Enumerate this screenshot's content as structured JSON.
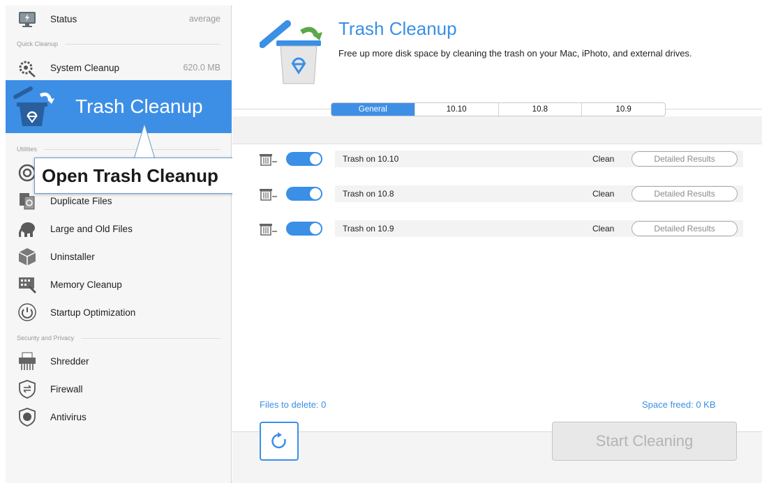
{
  "sidebar": {
    "status": {
      "label": "Status",
      "value": "average"
    },
    "section_quick": "Quick Cleanup",
    "system_cleanup": {
      "label": "System Cleanup",
      "value": "620.0 MB"
    },
    "selected": {
      "label": "Trash Cleanup"
    },
    "section_utilities": "Utilities",
    "duplicate_files": {
      "label": "Duplicate Files"
    },
    "large_old_files": {
      "label": "Large and Old Files"
    },
    "uninstaller": {
      "label": "Uninstaller"
    },
    "memory_cleanup": {
      "label": "Memory Cleanup"
    },
    "startup_optimization": {
      "label": "Startup Optimization"
    },
    "section_security": "Security and Privacy",
    "shredder": {
      "label": "Shredder"
    },
    "firewall": {
      "label": "Firewall"
    },
    "antivirus": {
      "label": "Antivirus"
    }
  },
  "callout": {
    "text": "Open Trash Cleanup"
  },
  "header": {
    "title": "Trash Cleanup",
    "subtitle": "Free up more disk space by cleaning the trash on your Mac, iPhoto, and external drives."
  },
  "tabs": [
    {
      "label": "General",
      "active": true
    },
    {
      "label": "10.10",
      "active": false
    },
    {
      "label": "10.8",
      "active": false
    },
    {
      "label": "10.9",
      "active": false
    }
  ],
  "items": [
    {
      "label": "Trash on 10.10",
      "status": "Clean",
      "button": "Detailed Results",
      "enabled": true
    },
    {
      "label": "Trash on 10.8",
      "status": "Clean",
      "button": "Detailed Results",
      "enabled": true
    },
    {
      "label": "Trash on 10.9",
      "status": "Clean",
      "button": "Detailed Results",
      "enabled": true
    }
  ],
  "footer": {
    "files_to_delete": "Files to delete: 0",
    "space_freed": "Space freed: 0 KB",
    "start_button": "Start Cleaning"
  },
  "colors": {
    "accent": "#3d8fe6",
    "sidebar_bg": "#f6f6f6"
  },
  "icons": {
    "status": "monitor-icon",
    "system_cleanup": "gear-broom-icon",
    "trash_cleanup": "recycle-bin-icon",
    "duplicate_files": "duplicate-files-icon",
    "large_old_files": "elephant-icon",
    "uninstaller": "box-icon",
    "memory_cleanup": "memory-chip-icon",
    "startup_optimization": "power-icon",
    "shredder": "shredder-icon",
    "firewall": "firewall-shield-icon",
    "antivirus": "antivirus-shield-icon",
    "refresh": "refresh-icon"
  }
}
